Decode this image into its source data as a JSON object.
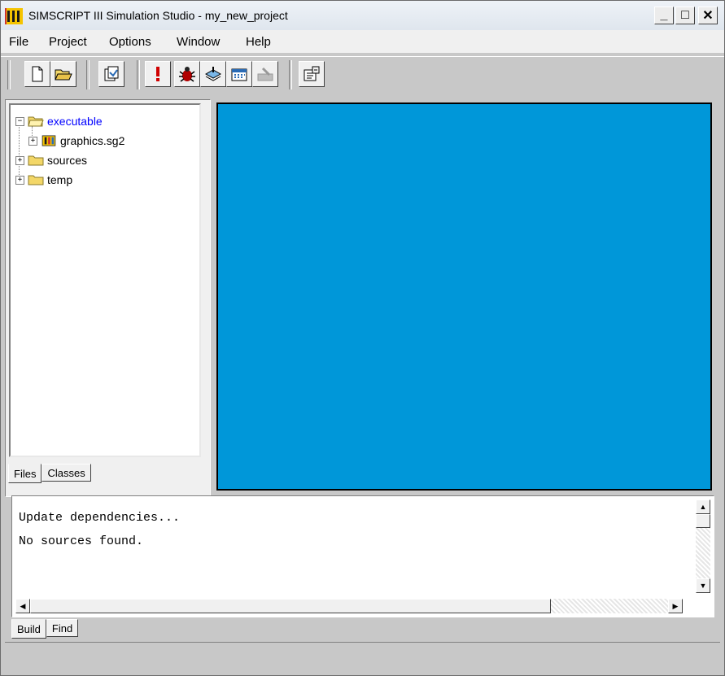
{
  "window": {
    "title": "SIMSCRIPT III Simulation Studio - my_new_project",
    "min_glyph": "_",
    "max_glyph": "□",
    "close_glyph": "✕"
  },
  "menu": {
    "file": "File",
    "project": "Project",
    "options": "Options",
    "window": "Window",
    "help": "Help"
  },
  "toolbar": {
    "icons": [
      "new-file-icon",
      "open-folder-icon",
      "properties-icon",
      "run-icon",
      "debug-bug-icon",
      "build-icon",
      "calendar-icon",
      "disabled-tool-icon",
      "settings-icon"
    ]
  },
  "tree": {
    "items": [
      {
        "label": "executable",
        "expander": "−",
        "selected": true
      },
      {
        "label": "graphics.sg2",
        "expander": "+"
      },
      {
        "label": "sources",
        "expander": "+"
      },
      {
        "label": "temp",
        "expander": "+"
      }
    ]
  },
  "left_tabs": {
    "files": "Files",
    "classes": "Classes"
  },
  "canvas": {
    "color": "#0097d9"
  },
  "output": {
    "lines": [
      "Update dependencies...",
      "No sources found."
    ]
  },
  "bottom_tabs": {
    "build": "Build",
    "find": "Find"
  },
  "colors": {
    "accent": "#0097d9",
    "link": "#0000ff",
    "folder": "#f3d768"
  }
}
